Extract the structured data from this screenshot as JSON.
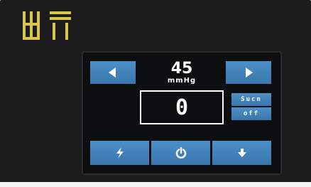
{
  "screen": {
    "pressure": {
      "value": "45",
      "unit": "mmHg"
    },
    "counter": "0",
    "suction_toggle": {
      "top_label": "Sucn",
      "bottom_label": "off"
    }
  },
  "icons": {
    "logo": "device-logo-icon",
    "left": "arrow-left-icon",
    "right": "arrow-right-icon",
    "flash": "lightning-icon",
    "power": "power-icon",
    "down": "arrow-down-icon"
  },
  "colors": {
    "button_blue": "#4a8cc4",
    "logo_yellow": "#d8c74a",
    "bezel": "#1c1c1c",
    "screen_bg": "#0d0e10"
  }
}
